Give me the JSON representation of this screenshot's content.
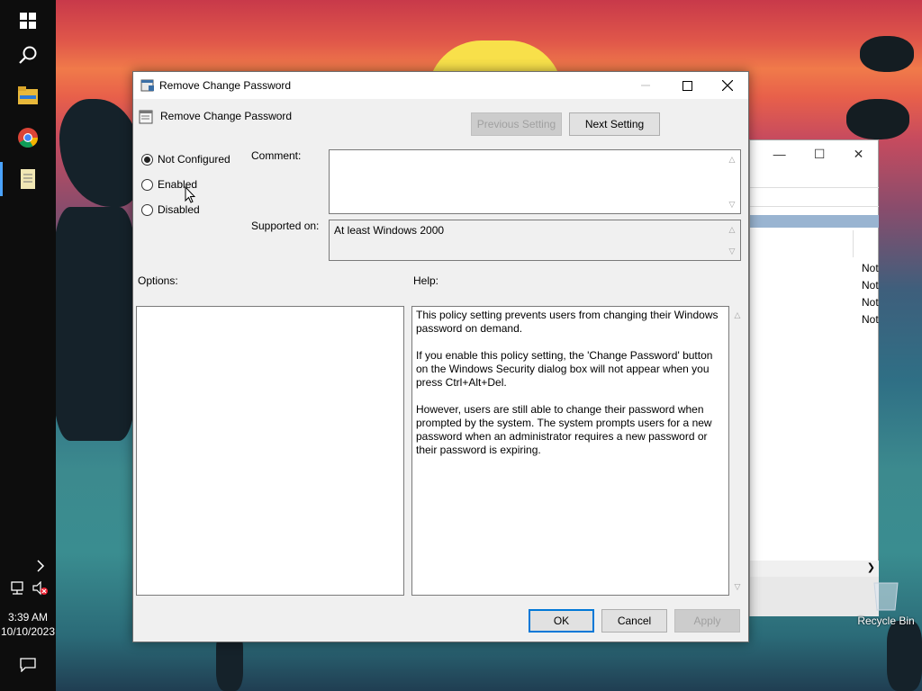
{
  "colors": {
    "accent": "#0078d7",
    "dialog_bg": "#f0f0f0",
    "taskbar_bg": "#0d0d0d"
  },
  "taskbar": {
    "icons": [
      "windows-start-icon",
      "search-icon",
      "file-explorer-icon",
      "chrome-icon",
      "notepad-icon"
    ],
    "tray": {
      "network_icon": "network-icon",
      "volume_icon": "volume-muted-icon",
      "expand_icon": "chevron-right-icon"
    },
    "time": "3:39 AM",
    "date": "10/10/2023",
    "notification_icon": "action-center-icon"
  },
  "background_window": {
    "rows": [
      "Not",
      "Not",
      "Not",
      "Not"
    ]
  },
  "desktop": {
    "recycle_bin_label": "Recycle Bin"
  },
  "dialog": {
    "title": "Remove Change Password",
    "policy_name": "Remove Change Password",
    "previous_label": "Previous Setting",
    "next_label": "Next Setting",
    "radios": {
      "not_configured": "Not Configured",
      "enabled": "Enabled",
      "disabled": "Disabled",
      "selected": "not_configured"
    },
    "comment_label": "Comment:",
    "comment_value": "",
    "supported_label": "Supported on:",
    "supported_value": "At least Windows 2000",
    "options_label": "Options:",
    "help_label": "Help:",
    "help_paragraphs": [
      "This policy setting prevents users from changing their Windows password on demand.",
      "If you enable this policy setting,  the 'Change Password' button on the Windows Security dialog box will not appear when you press Ctrl+Alt+Del.",
      "However, users are still able to change their password when prompted by the system. The system prompts users for a new password when an administrator requires a new password or their password is expiring."
    ],
    "ok_label": "OK",
    "cancel_label": "Cancel",
    "apply_label": "Apply"
  }
}
